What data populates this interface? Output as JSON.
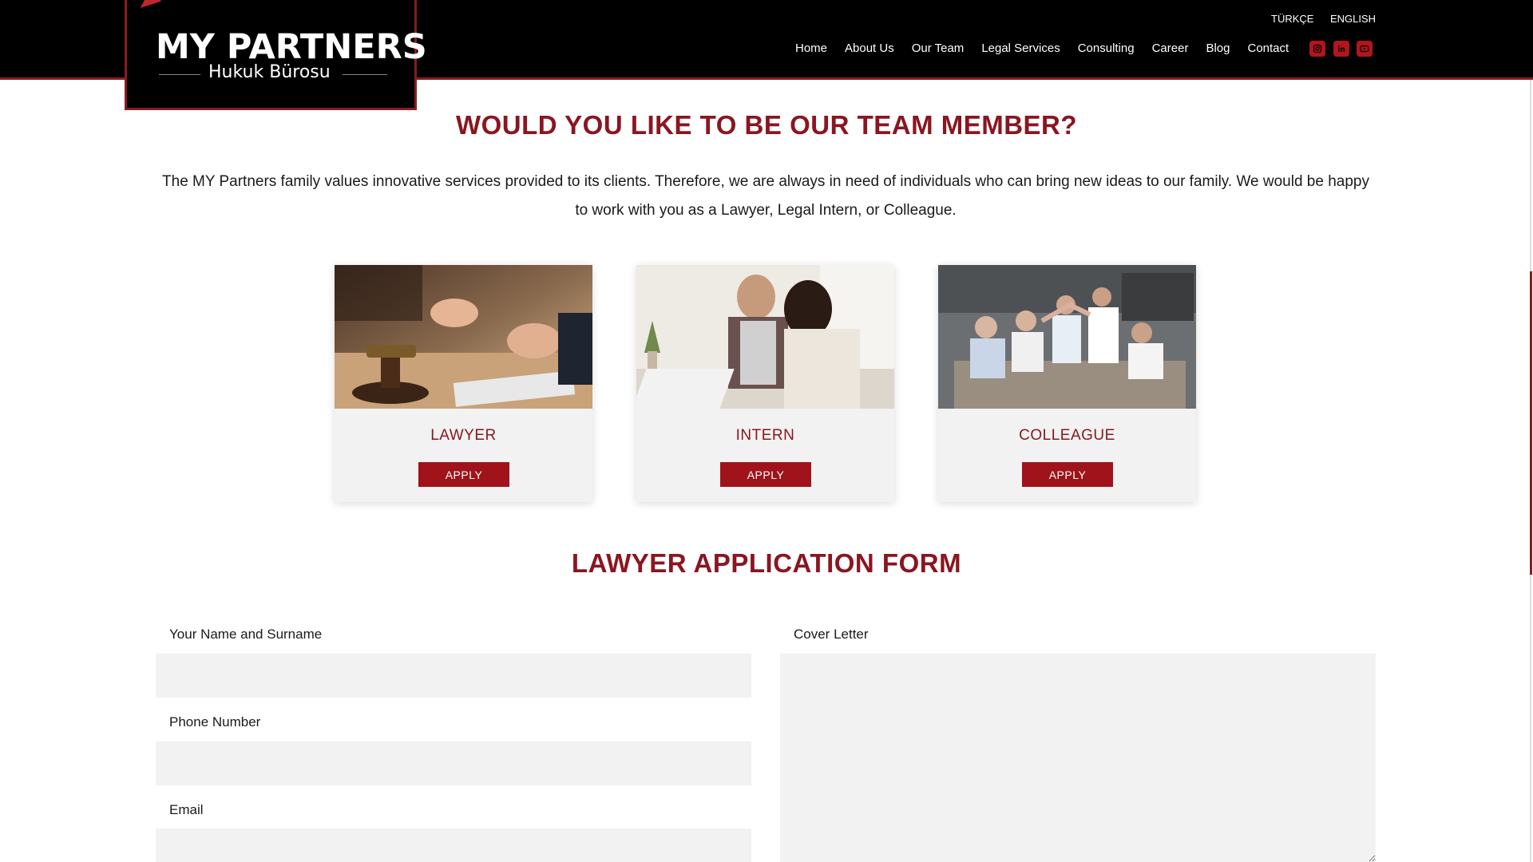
{
  "header": {
    "logo": {
      "main": "MY PARTNERS",
      "sub": "Hukuk Bürosu"
    },
    "languages": [
      "TÜRKÇE",
      "ENGLISH"
    ],
    "nav": [
      "Home",
      "About Us",
      "Our Team",
      "Legal Services",
      "Consulting",
      "Career",
      "Blog",
      "Contact"
    ],
    "social_icons": [
      "instagram-icon",
      "linkedin-icon",
      "youtube-icon"
    ]
  },
  "intro": {
    "title": "WOULD YOU LIKE TO BE OUR TEAM MEMBER?",
    "text": "The MY Partners family values innovative services provided to its clients. Therefore, we are always in need of individuals who can bring new ideas to our family. We would be happy to work with you as a Lawyer, Legal Intern, or Colleague."
  },
  "cards": [
    {
      "title": "LAWYER",
      "button": "APPLY"
    },
    {
      "title": "INTERN",
      "button": "APPLY"
    },
    {
      "title": "COLLEAGUE",
      "button": "APPLY"
    }
  ],
  "form": {
    "title": "LAWYER APPLICATION FORM",
    "fields": {
      "name_label": "Your Name and Surname",
      "phone_label": "Phone Number",
      "email_label": "Email",
      "cover_label": "Cover Letter"
    }
  },
  "colors": {
    "accent": "#8a1620",
    "button": "#a0131b",
    "header_bg": "#000000",
    "field_bg": "#f2f2f2"
  }
}
